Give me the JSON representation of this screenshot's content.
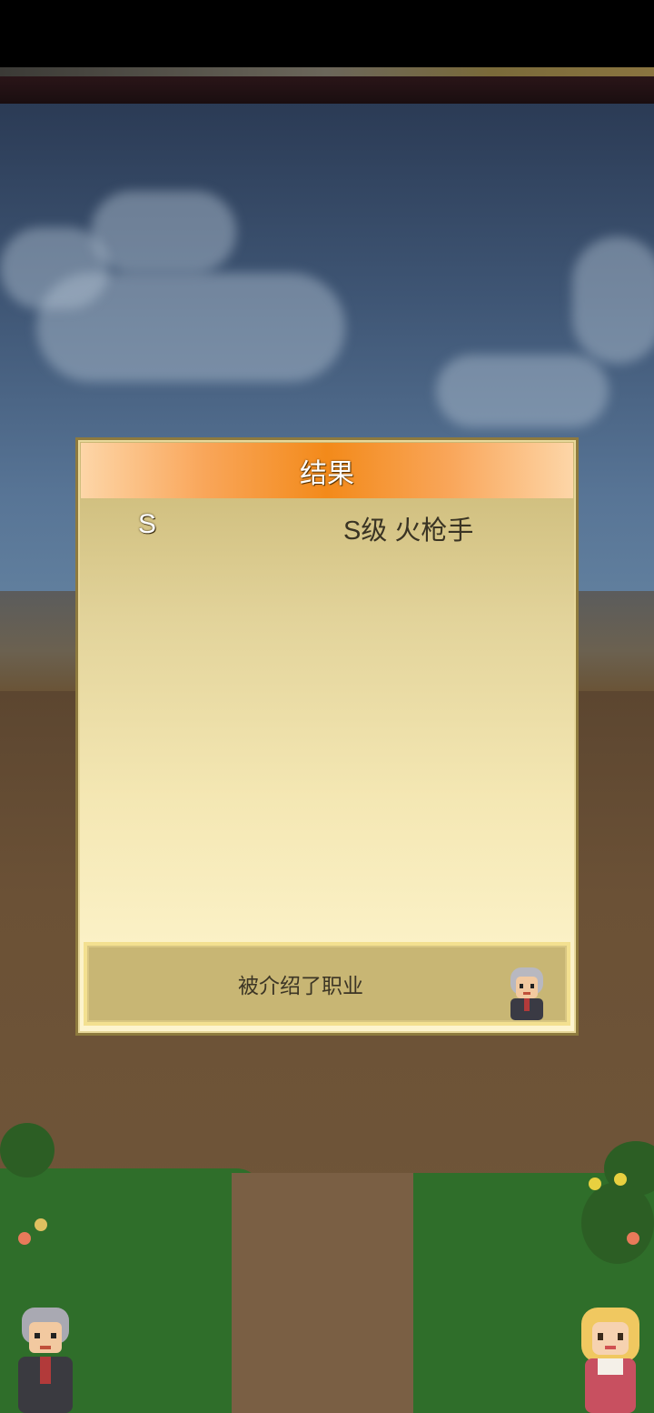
{
  "dialog": {
    "title": "结果",
    "results": [
      {
        "rank": "S",
        "text": "S级 火枪手"
      }
    ],
    "message": "被介绍了职业"
  },
  "icons": {
    "speaker": "elderly-advisor-portrait-icon",
    "left_character": "gray-haired-man-character-icon",
    "right_character": "blonde-girl-character-icon"
  },
  "colors": {
    "header_accent": "#f38a1a",
    "panel_light": "#fdf4cf",
    "panel_dark": "#c9b774",
    "message_bg": "#c8b674"
  }
}
